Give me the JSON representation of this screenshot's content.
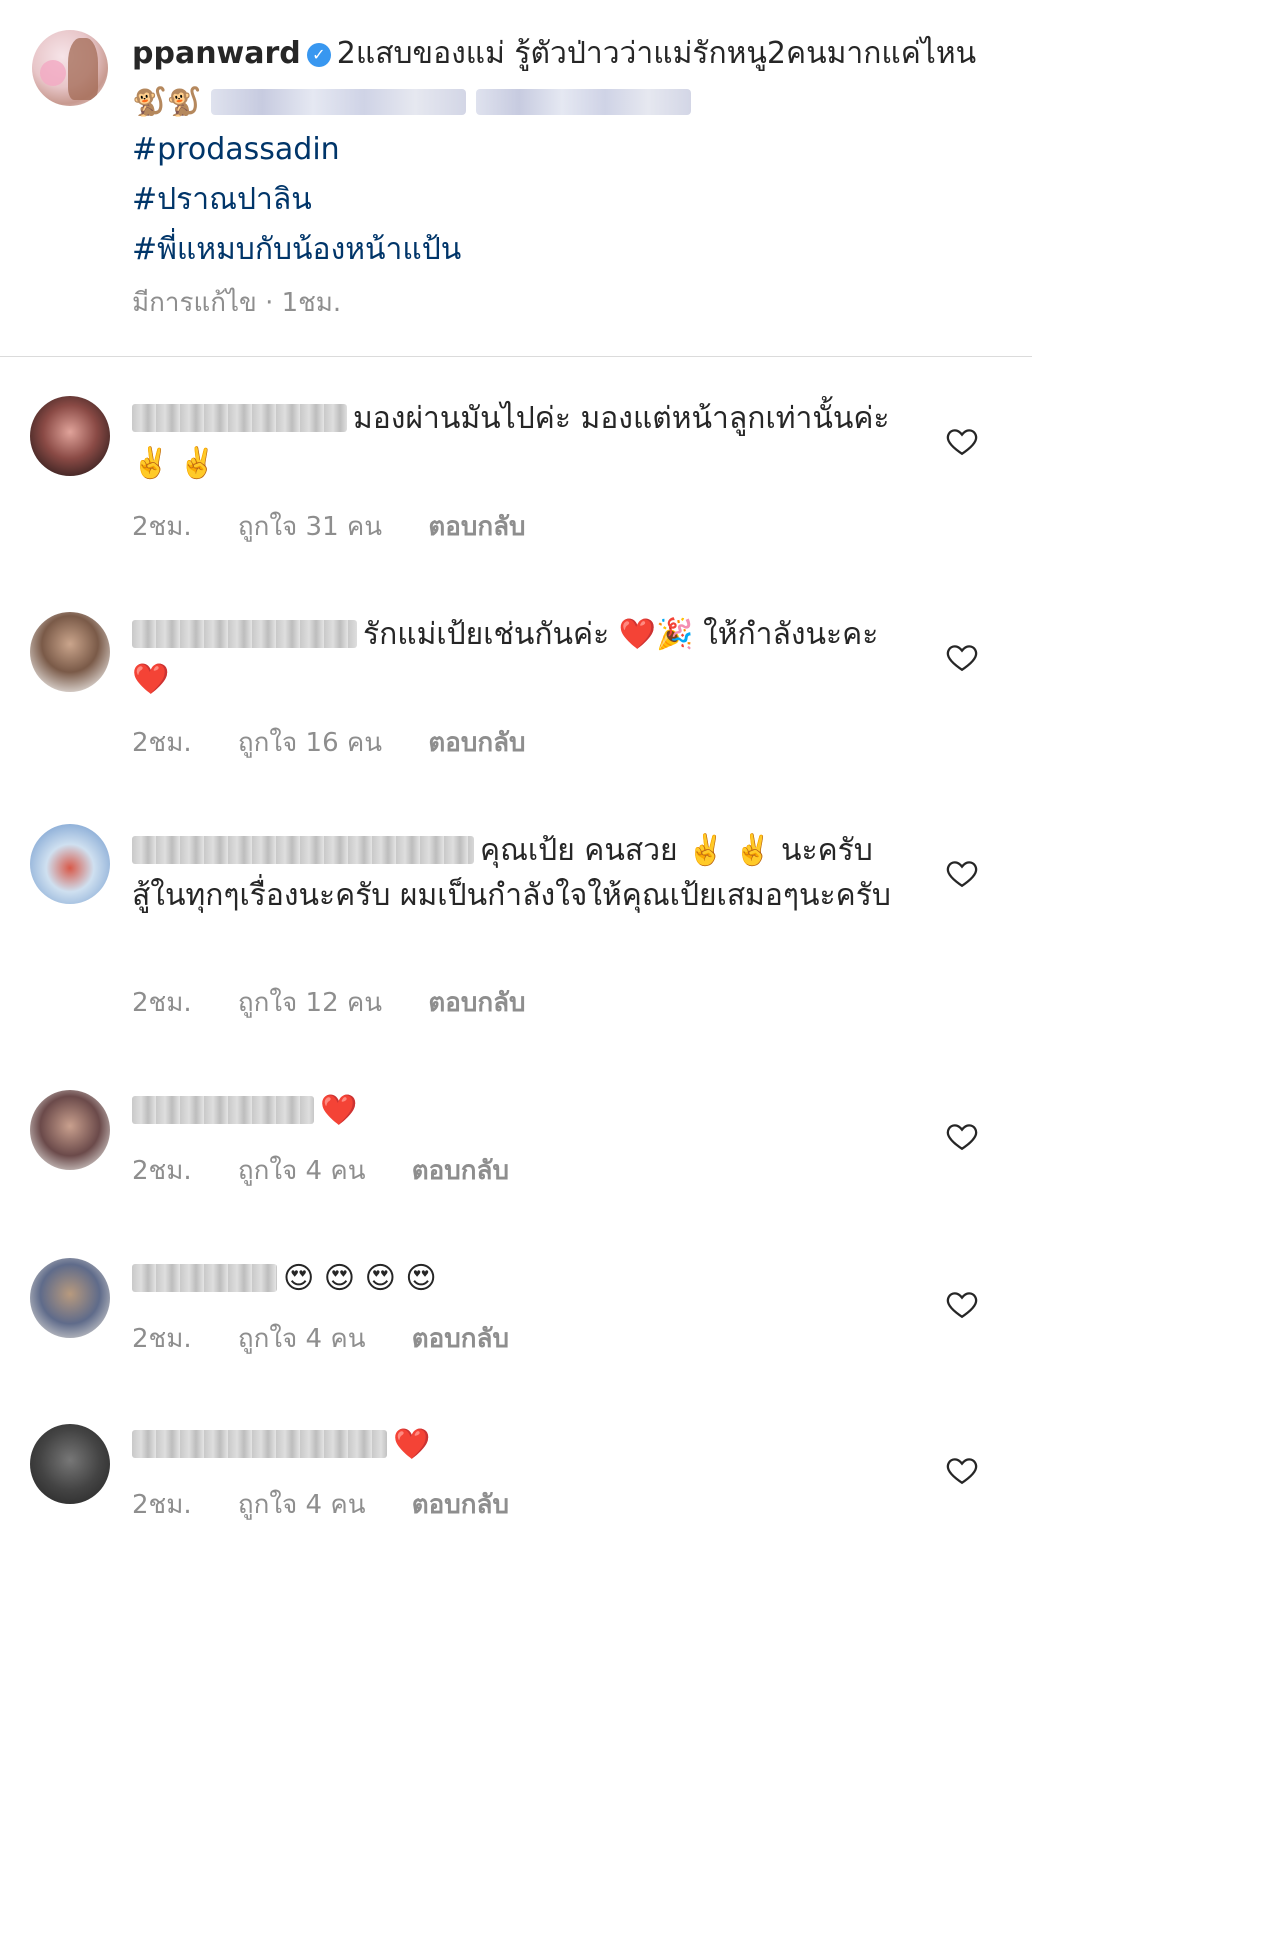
{
  "post": {
    "username": "ppanward",
    "verified_icon": "verified-badge-icon",
    "caption_line": "2แสบของแม่ รู้ตัวป่าวว่าแม่รักหนู2คนมากแค่ไหน",
    "emojis": "🐒🐒",
    "hashtags": [
      "#prodassadin",
      "#ปราณปาลิน",
      "#พี่แหมบกับน้องหน้าแป้น"
    ],
    "edited_label": "มีการแก้ไข",
    "time": "1ชม."
  },
  "comments": [
    {
      "text": "มองผ่านมันไปค่ะ มองแต่หน้าลูกเท่านั้นค่ะ",
      "emojis": "✌️ ✌️",
      "time": "2ชม.",
      "likes": "ถูกใจ 31 คน",
      "reply": "ตอบกลับ"
    },
    {
      "text": "รักแม่เป้ยเช่นกันค่ะ",
      "emojis_mid": "❤️🎉",
      "text2": "ให้กำลังนะคะ",
      "emojis": "❤️",
      "time": "2ชม.",
      "likes": "ถูกใจ 16 คน",
      "reply": "ตอบกลับ"
    },
    {
      "text": "คุณเป้ย คนสวย",
      "emojis_mid": "✌️ ✌️",
      "text2": "นะครับ สู้ในทุกๆเรื่องนะครับ ผมเป็นกำลังใจให้คุณเป้ยเสมอๆนะครับ",
      "time": "2ชม.",
      "likes": "ถูกใจ 12 คน",
      "reply": "ตอบกลับ"
    },
    {
      "emojis": "❤️",
      "time": "2ชม.",
      "likes": "ถูกใจ 4 คน",
      "reply": "ตอบกลับ"
    },
    {
      "emojis": "😍 😍 😍 😍",
      "time": "2ชม.",
      "likes": "ถูกใจ 4 คน",
      "reply": "ตอบกลับ"
    },
    {
      "emojis": "❤️",
      "time": "2ชม.",
      "likes": "ถูกใจ 4 คน",
      "reply": "ตอบกลับ"
    }
  ],
  "colors": {
    "hashtag": "#003569",
    "meta": "#8e8e8e",
    "verified": "#3897f0",
    "divider": "#dbdbdb"
  },
  "icons": [
    "heart-outline-icon",
    "verified-badge-icon"
  ]
}
